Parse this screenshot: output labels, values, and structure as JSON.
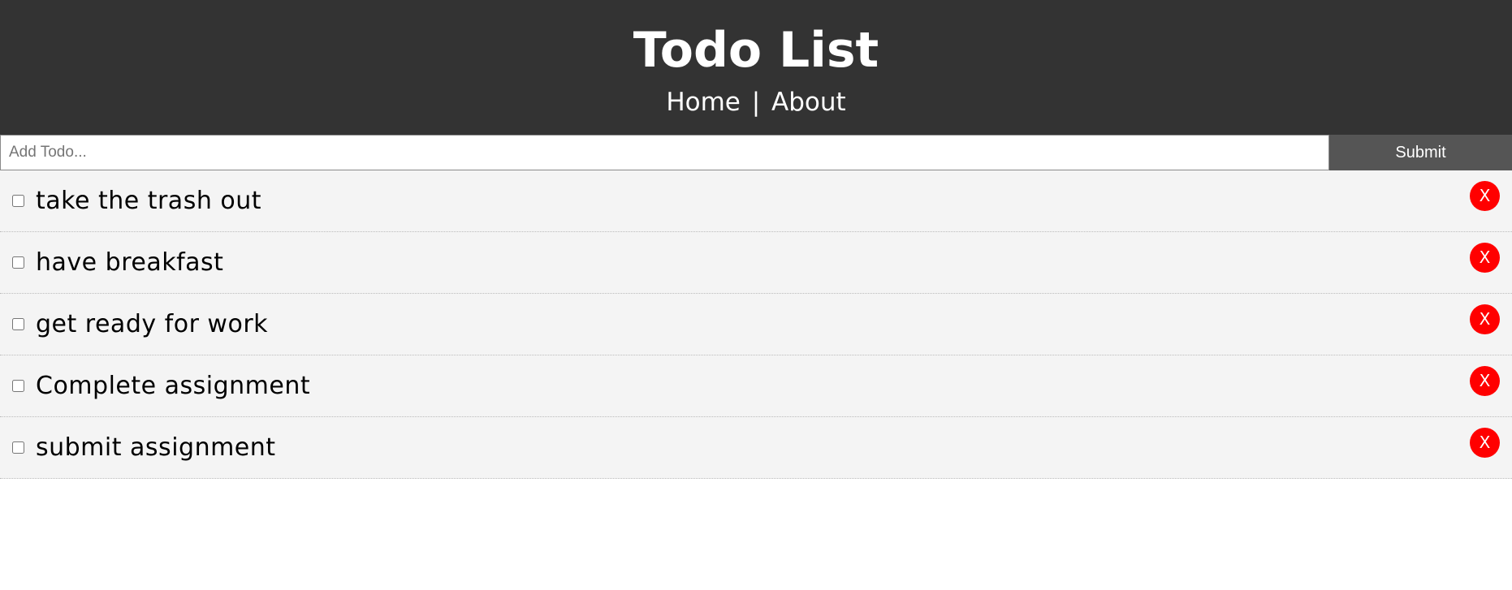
{
  "header": {
    "title": "Todo List",
    "nav": {
      "home": "Home",
      "separator": "|",
      "about": "About"
    }
  },
  "add_form": {
    "placeholder": "Add Todo...",
    "value": "",
    "submit_label": "Submit"
  },
  "todos": [
    {
      "title": "take the trash out",
      "completed": false,
      "delete_label": "X"
    },
    {
      "title": "have breakfast",
      "completed": false,
      "delete_label": "X"
    },
    {
      "title": "get ready for work",
      "completed": false,
      "delete_label": "X"
    },
    {
      "title": "Complete assignment",
      "completed": false,
      "delete_label": "X"
    },
    {
      "title": "submit assignment",
      "completed": false,
      "delete_label": "X"
    }
  ],
  "colors": {
    "header_bg": "#333333",
    "submit_bg": "#555555",
    "item_bg": "#f4f4f4",
    "delete_bg": "#ff0000"
  }
}
